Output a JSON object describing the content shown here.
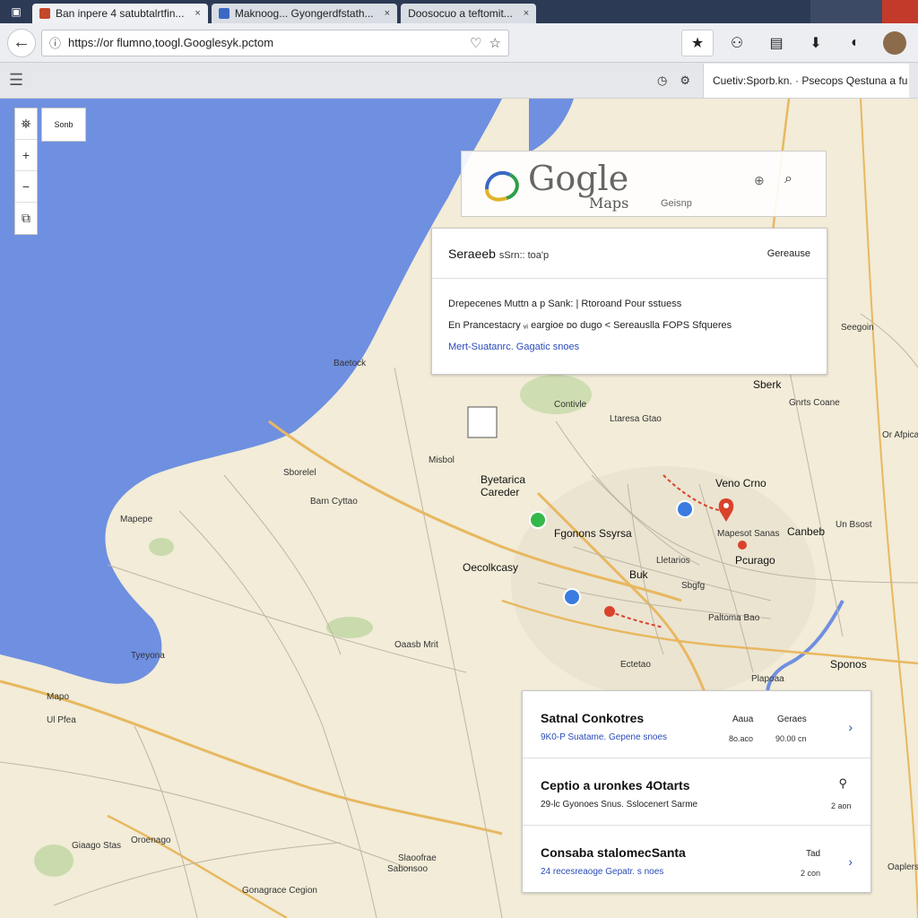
{
  "browser": {
    "tabs": [
      {
        "label": "Ban inpere 4 satubtalrtfin..."
      },
      {
        "label": "Maknoog... Gyongerdfstath..."
      },
      {
        "label": "Doosocuo a teftomit..."
      }
    ],
    "url": "https://or flumno,toogl.Googlesyk.pctom",
    "subbar_text": "Cuetiv:Sporb.kn. · Psecops Qestuna a fu"
  },
  "map_controls": {
    "zoom_in": "+",
    "zoom_out": "−",
    "minimap_label": "Sonb"
  },
  "logo": {
    "title": "Gogle",
    "subtitle": "Maps",
    "tag": "Geisnp"
  },
  "search_card": {
    "title": "Seraeeb",
    "title_small": "sSrn:: toa'p",
    "action": "Gereause",
    "rows": [
      "Drepecenes Muttn a p Sank: | Rtoroand Pour sstuess",
      "En Prancestacry ᵥᵢ eargioe ᴅo dugo < Sereauslla FOPS Sfqueres",
      "Mert-Suatanrc. Gagatic snoes"
    ]
  },
  "results": [
    {
      "title": "Satnal Conkotres",
      "sub": "9K0-P Suatame. Gepene snoes",
      "col1": "Aaua",
      "col2": "Geraes",
      "val1": "8o.aco",
      "val2": "90.00 ᴄn"
    },
    {
      "title": "Ceptio a uronkes 4Otarts",
      "sub": "29-lc Gyonoes Snus. Sslocenert Sarme",
      "val2": "2 aon"
    },
    {
      "title": "Consaba stalomecSanta",
      "sub": "24 recesreaoge Gepatr. s noes",
      "col2": "Tad",
      "val2": "2 con"
    }
  ],
  "map_labels": [
    {
      "text": "Baetock"
    },
    {
      "text": "Sberk"
    },
    {
      "text": "Seegoin"
    },
    {
      "text": "Contivle"
    },
    {
      "text": "Ltaresa Gtao"
    },
    {
      "text": "Gnrts Coane"
    },
    {
      "text": "Or Afpica"
    },
    {
      "text": "Misbol"
    },
    {
      "text": "Byetarica Careder"
    },
    {
      "text": "Veno Crno"
    },
    {
      "text": "Sborelel"
    },
    {
      "text": "Barn Cyttao"
    },
    {
      "text": "Mapepe"
    },
    {
      "text": "Fgonons Ssyrsa"
    },
    {
      "text": "Mapesot Sanas"
    },
    {
      "text": "Canbeb"
    },
    {
      "text": "Un Bsost"
    },
    {
      "text": "Oecolkcasy"
    },
    {
      "text": "Buk"
    },
    {
      "text": "Lletarios"
    },
    {
      "text": "Pcurago"
    },
    {
      "text": "Sbgfg"
    },
    {
      "text": "Paltoma Bao"
    },
    {
      "text": "Oaasb Mrit"
    },
    {
      "text": "Ectetao"
    },
    {
      "text": "Sponos"
    },
    {
      "text": "Plapoaa"
    },
    {
      "text": "Tyeyona"
    },
    {
      "text": "Mapo"
    },
    {
      "text": "Ul Pfea"
    },
    {
      "text": "Giaago Stas"
    },
    {
      "text": "Oroenago"
    },
    {
      "text": "Slaoofrae"
    },
    {
      "text": "Sabonsoo"
    },
    {
      "text": "Gonagrace Cegion"
    },
    {
      "text": "Oaplers"
    }
  ],
  "colors": {
    "water": "#6f8fe0",
    "land": "#f2ecd8",
    "road_major": "#e8b860",
    "park": "#b8d49a",
    "pin_red": "#d9432b",
    "pin_blue": "#3a7be0",
    "pin_green": "#35b84a"
  }
}
